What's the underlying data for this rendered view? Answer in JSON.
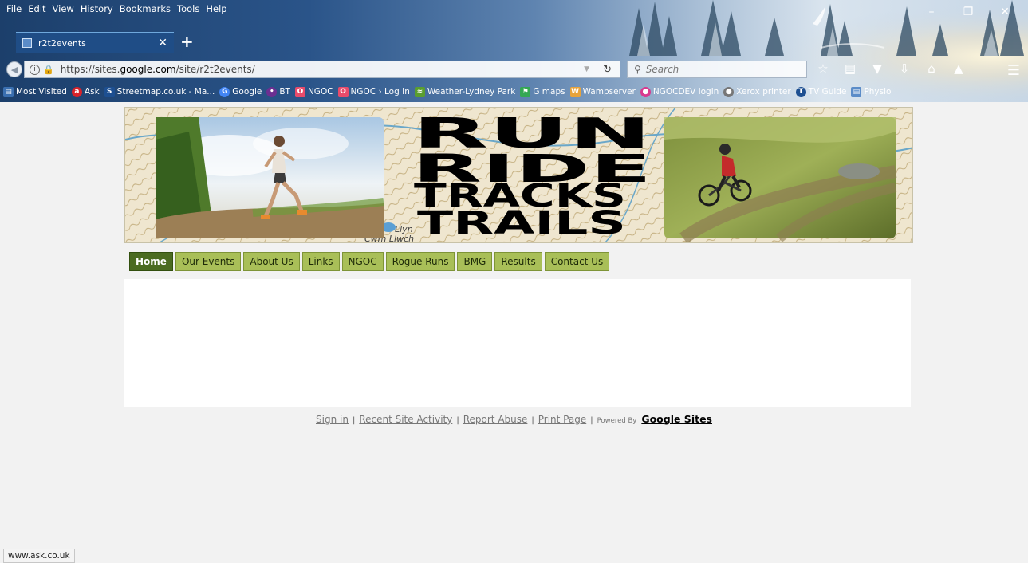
{
  "browser": {
    "menu": [
      "File",
      "Edit",
      "View",
      "History",
      "Bookmarks",
      "Tools",
      "Help"
    ],
    "tab_title": "r2t2events",
    "url_prefix": "https://sites.",
    "url_domain": "google.com",
    "url_path": "/site/r2t2events/",
    "search_placeholder": "Search",
    "bookmarks": [
      {
        "label": "Most Visited",
        "icon": "most-visited-icon",
        "color": "#3a6fb0"
      },
      {
        "label": "Ask",
        "icon": "ask-icon",
        "color": "#d9232a"
      },
      {
        "label": "Streetmap.co.uk - Ma...",
        "icon": "streetmap-icon",
        "color": "#1d4f91"
      },
      {
        "label": "Google",
        "icon": "google-icon",
        "color": "#4285f4"
      },
      {
        "label": "BT",
        "icon": "bt-icon",
        "color": "#6b2f91"
      },
      {
        "label": "NGOC",
        "icon": "ngoc-icon",
        "color": "#e84b6b"
      },
      {
        "label": "NGOC › Log In",
        "icon": "ngoc-icon",
        "color": "#e84b6b"
      },
      {
        "label": "Weather-Lydney Park",
        "icon": "weather-icon",
        "color": "#5a9e2f"
      },
      {
        "label": "G maps",
        "icon": "gmaps-icon",
        "color": "#34a853"
      },
      {
        "label": "Wampserver",
        "icon": "wampserver-icon",
        "color": "#e8a33a"
      },
      {
        "label": "NGOCDEV login",
        "icon": "ngocdev-icon",
        "color": "#d93a8f"
      },
      {
        "label": "Xerox printer",
        "icon": "xerox-icon",
        "color": "#777777"
      },
      {
        "label": "TV Guide",
        "icon": "tvguide-icon",
        "color": "#1d4f91"
      },
      {
        "label": "Physio",
        "icon": "physio-icon",
        "color": "#5b8cc8"
      }
    ],
    "status_text": "www.ask.co.uk"
  },
  "site": {
    "banner": {
      "words": [
        "RUN",
        "RIDE",
        "TRACKS",
        "TRAILS"
      ],
      "map_labels": [
        "Cwm Llwch",
        "Llyn"
      ]
    },
    "nav": [
      {
        "label": "Home",
        "active": true
      },
      {
        "label": "Our Events",
        "active": false
      },
      {
        "label": "About Us",
        "active": false
      },
      {
        "label": "Links",
        "active": false
      },
      {
        "label": "NGOC",
        "active": false
      },
      {
        "label": "Rogue Runs",
        "active": false
      },
      {
        "label": "BMG",
        "active": false
      },
      {
        "label": "Results",
        "active": false
      },
      {
        "label": "Contact Us",
        "active": false
      }
    ],
    "footer": {
      "sign_in": "Sign in",
      "recent_activity": "Recent Site Activity",
      "report_abuse": "Report Abuse",
      "print_page": "Print Page",
      "powered_by": "Powered By",
      "google_sites": "Google Sites",
      "separator": "|"
    }
  },
  "colors": {
    "nav_bg": "#a9bf58",
    "nav_active_bg": "#4b6b21",
    "page_bg": "#f2f2f2"
  }
}
